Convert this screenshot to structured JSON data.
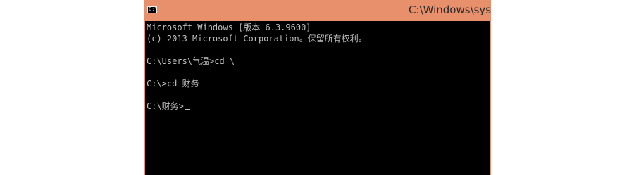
{
  "window": {
    "title": "C:\\Windows\\sys",
    "icon": "console-icon",
    "icon_glyph": "C:\\",
    "frame_color": "#e8906c"
  },
  "console": {
    "background": "#000000",
    "text_color": "#c0c0c0",
    "lines": [
      "Microsoft Windows [版本 6.3.9600]",
      "(c) 2013 Microsoft Corporation。保留所有权利。",
      "C:\\Users\\气温>cd \\",
      "C:\\>cd 财务",
      "C:\\财务>"
    ]
  }
}
